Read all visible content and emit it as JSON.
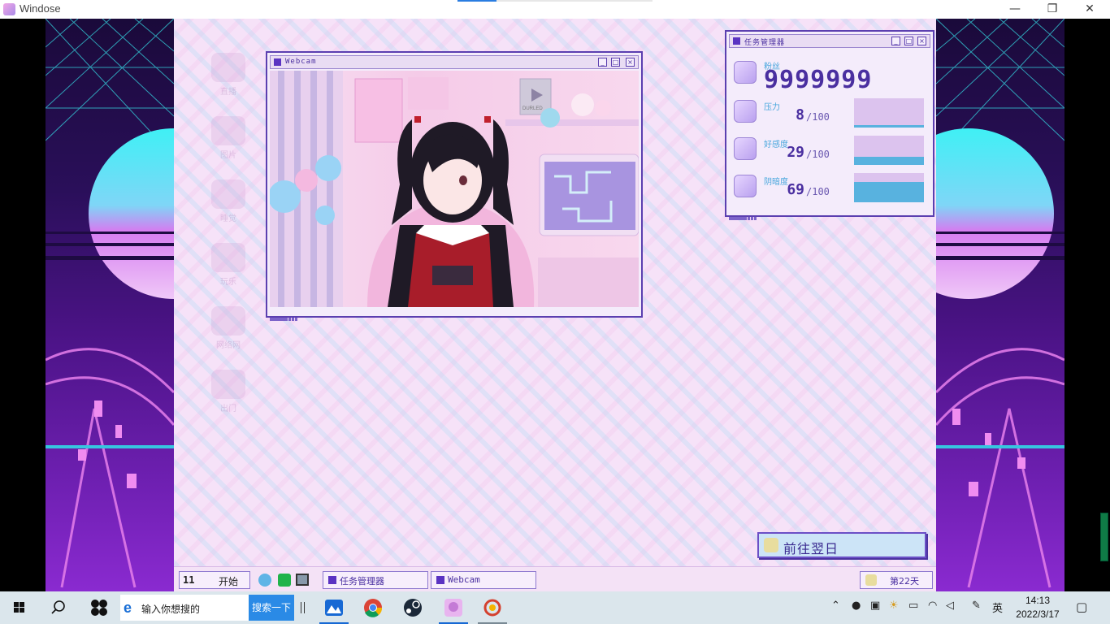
{
  "host_window": {
    "title": "Windose",
    "minimize": "—",
    "restore": "❐",
    "close": "✕",
    "progress_fraction": 0.2
  },
  "desktop_icons": [
    {
      "label": "直播",
      "icon": "stream-icon"
    },
    {
      "label": "图片",
      "icon": "images-icon"
    },
    {
      "label": "睡觉",
      "icon": "sleep-icon"
    },
    {
      "label": "玩乐",
      "icon": "play-icon"
    },
    {
      "label": "网络网",
      "icon": "internet-icon"
    },
    {
      "label": "出门",
      "icon": "go-out-icon"
    }
  ],
  "webcam_window": {
    "title": "Webcam",
    "sticker": "DURLED"
  },
  "task_manager": {
    "title": "任务管理器",
    "followers_label": "粉丝",
    "followers_value": "9999999",
    "stats": [
      {
        "label": "压力",
        "value": "8",
        "max": "/100",
        "level": 0.08
      },
      {
        "label": "好感度",
        "value": "29",
        "max": "/100",
        "level": 0.29
      },
      {
        "label": "阴暗度",
        "value": "69",
        "max": "/100",
        "level": 0.69
      }
    ]
  },
  "next_day_button": {
    "label": "前往翌日",
    "icon": "moon-icon"
  },
  "game_taskbar": {
    "start_label": "开始",
    "start_prefix": "11",
    "quick_icons": [
      "twitter-icon",
      "line-icon",
      "monitor-icon"
    ],
    "window_buttons": [
      "任务管理器",
      "Webcam"
    ],
    "day_label": "第22天"
  },
  "windows_taskbar": {
    "search_placeholder": "输入你想搜的",
    "search_button": "搜索一下",
    "clock_time": "14:13",
    "clock_date": "2022/3/17",
    "ime": "英",
    "pinned": [
      "start-icon",
      "search-icon",
      "fan-icon",
      "edge-icon",
      "app-mountain-icon",
      "chrome-icon",
      "steam-icon",
      "windose-icon",
      "app-ring-icon"
    ],
    "tray_icons": [
      "chevron-up-icon",
      "mic-icon",
      "display-icon",
      "weather-icon",
      "battery-icon",
      "wifi-icon",
      "volume-icon",
      "pen-icon",
      "notification-icon"
    ]
  },
  "colors": {
    "accent": "#5a33c2",
    "meter_fill": "#58b2df",
    "meter_bg": "#dcc3ee",
    "desktop_bg": "#f6e2f8"
  }
}
